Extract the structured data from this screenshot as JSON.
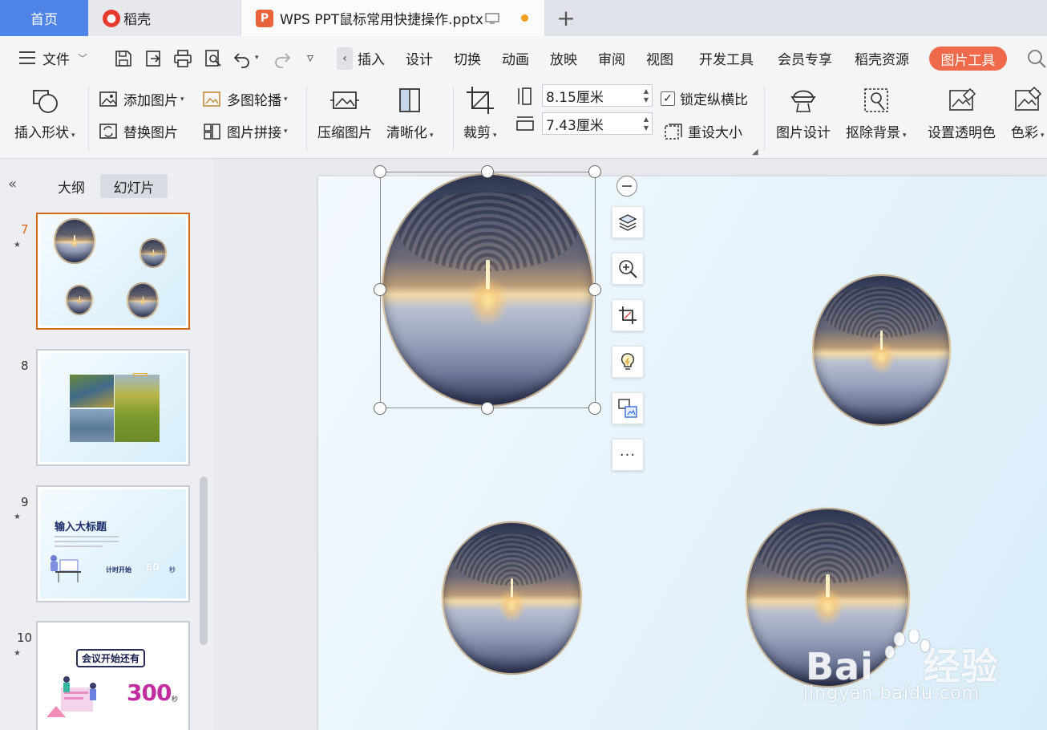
{
  "tabs": {
    "home": "首页",
    "daoke": "稻壳",
    "document": "WPS PPT鼠标常用快捷操作.pptx"
  },
  "menu": {
    "file": "文件",
    "items": [
      "插入",
      "设计",
      "切换",
      "动画",
      "放映",
      "审阅",
      "视图",
      "开发工具",
      "会员专享",
      "稻壳资源"
    ],
    "picture_tools": "图片工具"
  },
  "ribbon": {
    "insert_shape": "插入形状",
    "add_picture": "添加图片",
    "replace_picture": "替换图片",
    "multi_carousel": "多图轮播",
    "picture_collage": "图片拼接",
    "compress_picture": "压缩图片",
    "sharpen": "清晰化",
    "crop": "裁剪",
    "height_value": "8.15厘米",
    "width_value": "7.43厘米",
    "lock_ratio": "锁定纵横比",
    "reset_size": "重设大小",
    "picture_design": "图片设计",
    "remove_background": "抠除背景",
    "set_transparent": "设置透明色",
    "color": "色彩"
  },
  "left_pane": {
    "outline_tab": "大纲",
    "slides_tab": "幻灯片",
    "slides": [
      {
        "number": "7",
        "active": true
      },
      {
        "number": "8",
        "active": false
      },
      {
        "number": "9",
        "active": false,
        "title": "输入大标题",
        "timer_label": "计时开始",
        "timer_value": "60",
        "timer_unit": "秒"
      },
      {
        "number": "10",
        "active": false,
        "title": "会议开始还有",
        "count": "300",
        "unit": "秒"
      }
    ]
  },
  "watermark": {
    "brand": "Bai",
    "brand2": "经验",
    "url": "jingyan.baidu.com"
  }
}
